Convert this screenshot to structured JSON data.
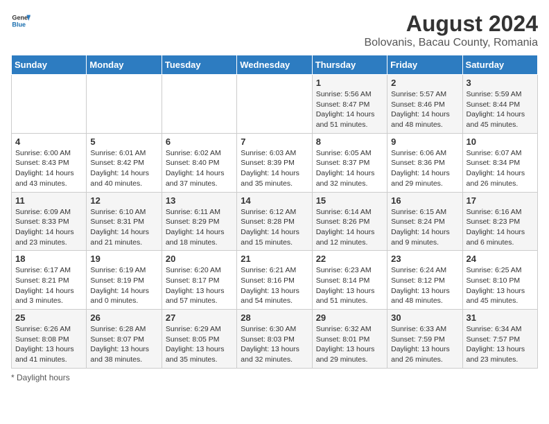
{
  "header": {
    "logo_general": "General",
    "logo_blue": "Blue",
    "title": "August 2024",
    "subtitle": "Bolovanis, Bacau County, Romania"
  },
  "days_of_week": [
    "Sunday",
    "Monday",
    "Tuesday",
    "Wednesday",
    "Thursday",
    "Friday",
    "Saturday"
  ],
  "weeks": [
    [
      {
        "day": "",
        "info": ""
      },
      {
        "day": "",
        "info": ""
      },
      {
        "day": "",
        "info": ""
      },
      {
        "day": "",
        "info": ""
      },
      {
        "day": "1",
        "info": "Sunrise: 5:56 AM\nSunset: 8:47 PM\nDaylight: 14 hours and 51 minutes."
      },
      {
        "day": "2",
        "info": "Sunrise: 5:57 AM\nSunset: 8:46 PM\nDaylight: 14 hours and 48 minutes."
      },
      {
        "day": "3",
        "info": "Sunrise: 5:59 AM\nSunset: 8:44 PM\nDaylight: 14 hours and 45 minutes."
      }
    ],
    [
      {
        "day": "4",
        "info": "Sunrise: 6:00 AM\nSunset: 8:43 PM\nDaylight: 14 hours and 43 minutes."
      },
      {
        "day": "5",
        "info": "Sunrise: 6:01 AM\nSunset: 8:42 PM\nDaylight: 14 hours and 40 minutes."
      },
      {
        "day": "6",
        "info": "Sunrise: 6:02 AM\nSunset: 8:40 PM\nDaylight: 14 hours and 37 minutes."
      },
      {
        "day": "7",
        "info": "Sunrise: 6:03 AM\nSunset: 8:39 PM\nDaylight: 14 hours and 35 minutes."
      },
      {
        "day": "8",
        "info": "Sunrise: 6:05 AM\nSunset: 8:37 PM\nDaylight: 14 hours and 32 minutes."
      },
      {
        "day": "9",
        "info": "Sunrise: 6:06 AM\nSunset: 8:36 PM\nDaylight: 14 hours and 29 minutes."
      },
      {
        "day": "10",
        "info": "Sunrise: 6:07 AM\nSunset: 8:34 PM\nDaylight: 14 hours and 26 minutes."
      }
    ],
    [
      {
        "day": "11",
        "info": "Sunrise: 6:09 AM\nSunset: 8:33 PM\nDaylight: 14 hours and 23 minutes."
      },
      {
        "day": "12",
        "info": "Sunrise: 6:10 AM\nSunset: 8:31 PM\nDaylight: 14 hours and 21 minutes."
      },
      {
        "day": "13",
        "info": "Sunrise: 6:11 AM\nSunset: 8:29 PM\nDaylight: 14 hours and 18 minutes."
      },
      {
        "day": "14",
        "info": "Sunrise: 6:12 AM\nSunset: 8:28 PM\nDaylight: 14 hours and 15 minutes."
      },
      {
        "day": "15",
        "info": "Sunrise: 6:14 AM\nSunset: 8:26 PM\nDaylight: 14 hours and 12 minutes."
      },
      {
        "day": "16",
        "info": "Sunrise: 6:15 AM\nSunset: 8:24 PM\nDaylight: 14 hours and 9 minutes."
      },
      {
        "day": "17",
        "info": "Sunrise: 6:16 AM\nSunset: 8:23 PM\nDaylight: 14 hours and 6 minutes."
      }
    ],
    [
      {
        "day": "18",
        "info": "Sunrise: 6:17 AM\nSunset: 8:21 PM\nDaylight: 14 hours and 3 minutes."
      },
      {
        "day": "19",
        "info": "Sunrise: 6:19 AM\nSunset: 8:19 PM\nDaylight: 14 hours and 0 minutes."
      },
      {
        "day": "20",
        "info": "Sunrise: 6:20 AM\nSunset: 8:17 PM\nDaylight: 13 hours and 57 minutes."
      },
      {
        "day": "21",
        "info": "Sunrise: 6:21 AM\nSunset: 8:16 PM\nDaylight: 13 hours and 54 minutes."
      },
      {
        "day": "22",
        "info": "Sunrise: 6:23 AM\nSunset: 8:14 PM\nDaylight: 13 hours and 51 minutes."
      },
      {
        "day": "23",
        "info": "Sunrise: 6:24 AM\nSunset: 8:12 PM\nDaylight: 13 hours and 48 minutes."
      },
      {
        "day": "24",
        "info": "Sunrise: 6:25 AM\nSunset: 8:10 PM\nDaylight: 13 hours and 45 minutes."
      }
    ],
    [
      {
        "day": "25",
        "info": "Sunrise: 6:26 AM\nSunset: 8:08 PM\nDaylight: 13 hours and 41 minutes."
      },
      {
        "day": "26",
        "info": "Sunrise: 6:28 AM\nSunset: 8:07 PM\nDaylight: 13 hours and 38 minutes."
      },
      {
        "day": "27",
        "info": "Sunrise: 6:29 AM\nSunset: 8:05 PM\nDaylight: 13 hours and 35 minutes."
      },
      {
        "day": "28",
        "info": "Sunrise: 6:30 AM\nSunset: 8:03 PM\nDaylight: 13 hours and 32 minutes."
      },
      {
        "day": "29",
        "info": "Sunrise: 6:32 AM\nSunset: 8:01 PM\nDaylight: 13 hours and 29 minutes."
      },
      {
        "day": "30",
        "info": "Sunrise: 6:33 AM\nSunset: 7:59 PM\nDaylight: 13 hours and 26 minutes."
      },
      {
        "day": "31",
        "info": "Sunrise: 6:34 AM\nSunset: 7:57 PM\nDaylight: 13 hours and 23 minutes."
      }
    ]
  ],
  "footer": {
    "note": "Daylight hours"
  }
}
